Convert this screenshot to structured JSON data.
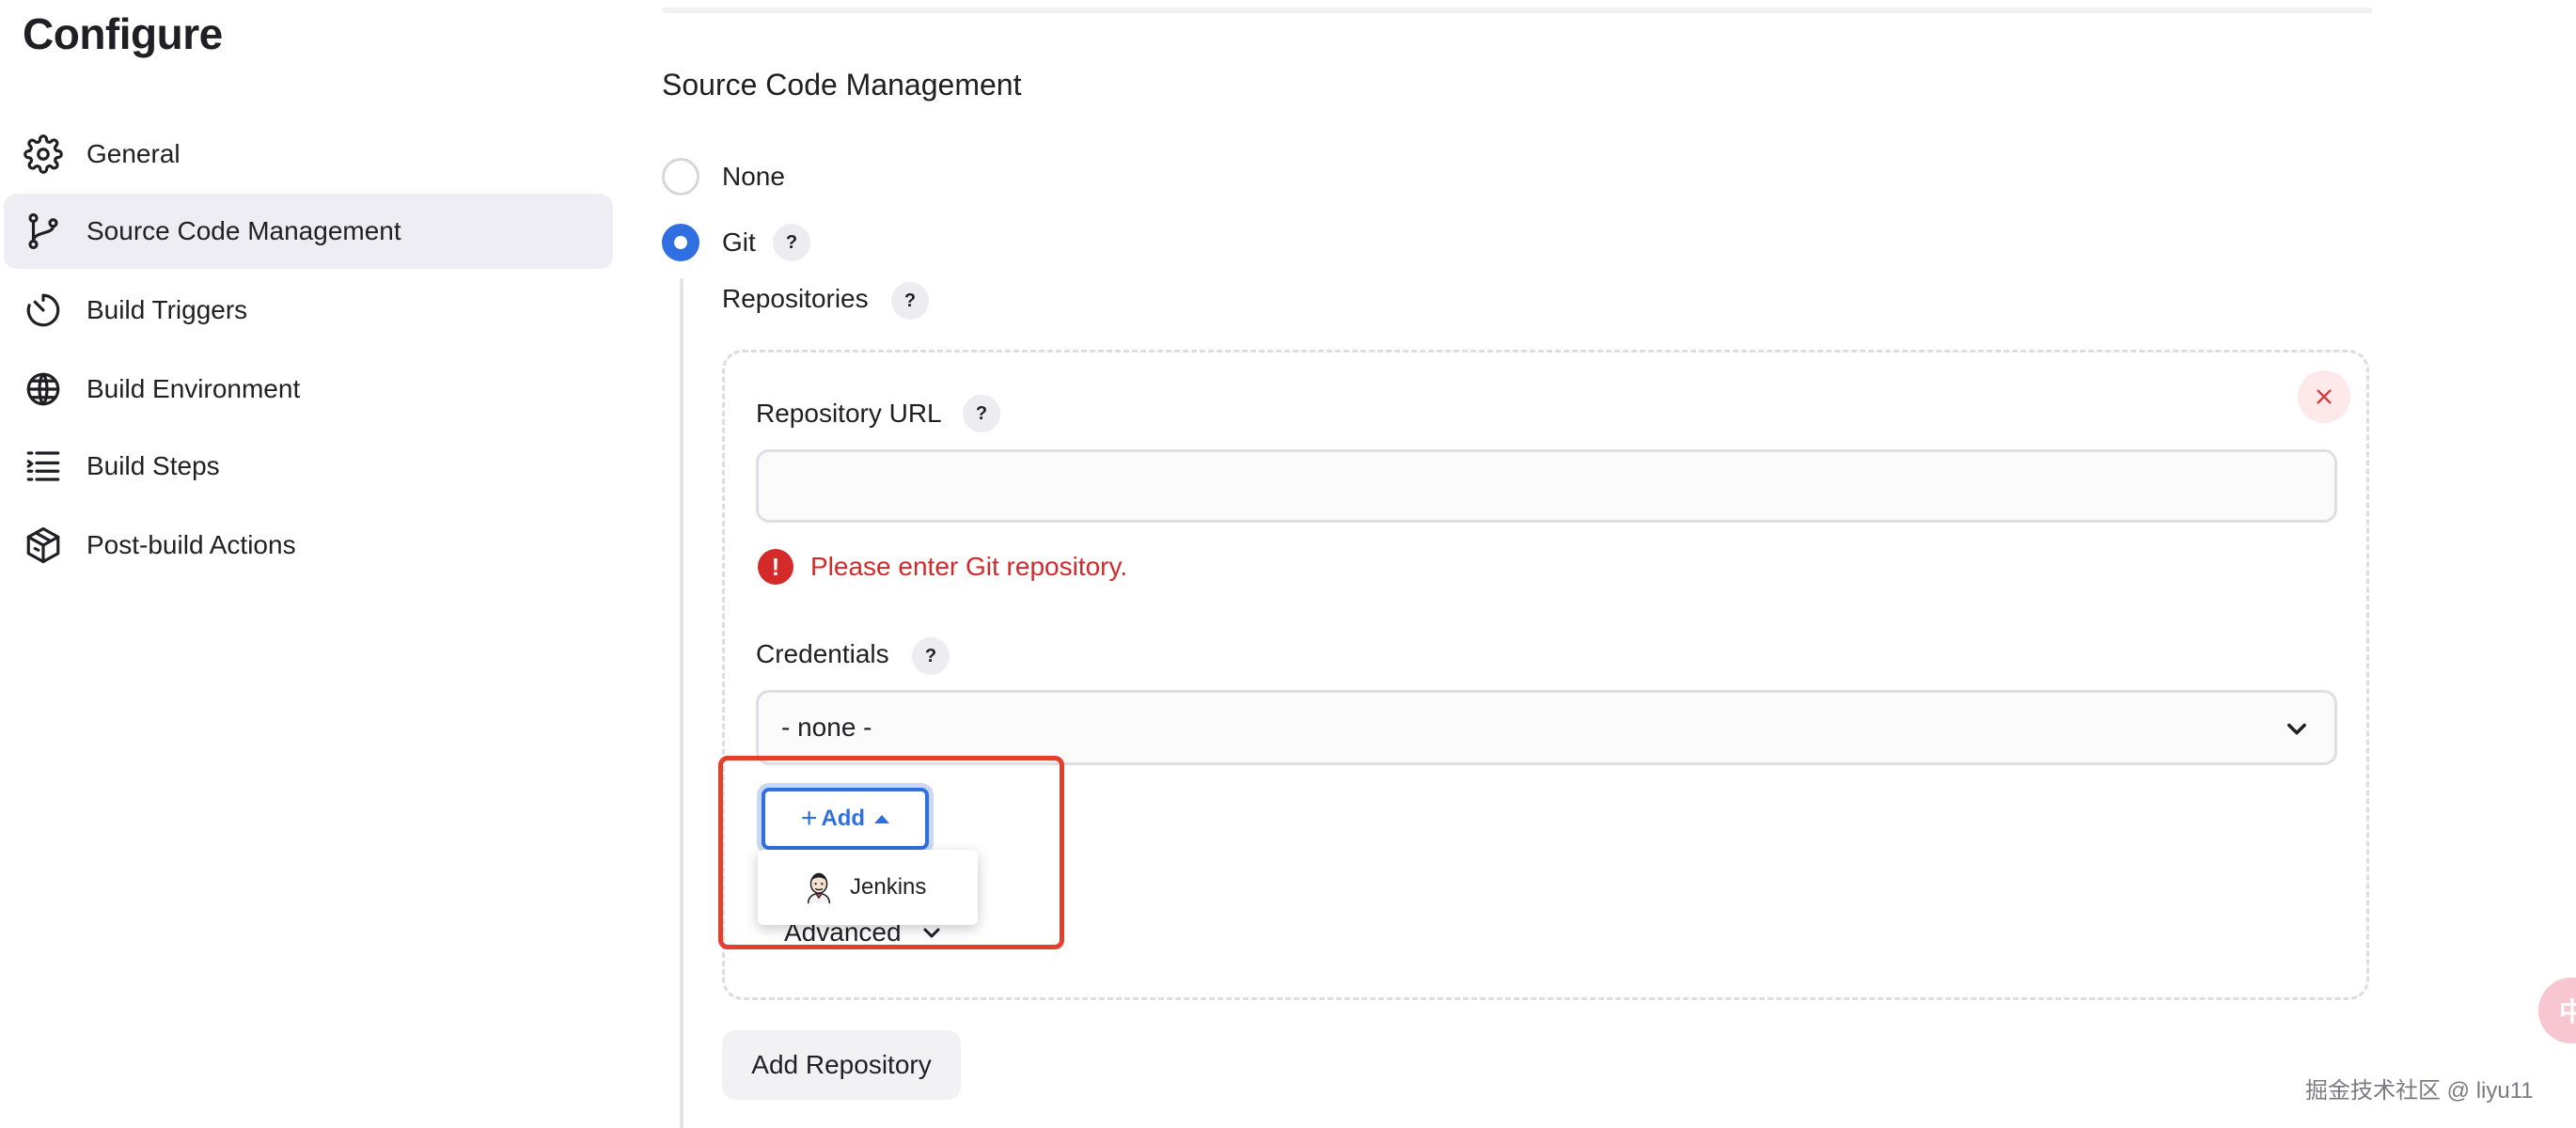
{
  "sidebar": {
    "title": "Configure",
    "items": [
      {
        "label": "General",
        "icon": "gear-icon",
        "active": false
      },
      {
        "label": "Source Code Management",
        "icon": "git-branch-icon",
        "active": true
      },
      {
        "label": "Build Triggers",
        "icon": "timer-icon",
        "active": false
      },
      {
        "label": "Build Environment",
        "icon": "globe-icon",
        "active": false
      },
      {
        "label": "Build Steps",
        "icon": "list-icon",
        "active": false
      },
      {
        "label": "Post-build Actions",
        "icon": "package-icon",
        "active": false
      }
    ]
  },
  "scm": {
    "title": "Source Code Management",
    "options": [
      {
        "label": "None",
        "selected": false
      },
      {
        "label": "Git",
        "selected": true
      }
    ],
    "help_symbol": "?",
    "repositories_label": "Repositories",
    "repo_url_label": "Repository URL",
    "repo_url_value": "",
    "repo_url_placeholder": "",
    "error_symbol": "!",
    "error_message": "Please enter Git repository.",
    "credentials_label": "Credentials",
    "credentials_selected": "- none -",
    "add_button": {
      "plus": "+",
      "label": "Add"
    },
    "dropdown_items": [
      {
        "label": "Jenkins",
        "icon": "jenkins-icon"
      }
    ],
    "advanced_label": "Advanced",
    "add_repository_label": "Add Repository"
  },
  "overlay": {
    "watermark": "掘金技术社区 @ liyu11",
    "side_bubble": "中"
  },
  "colors": {
    "accent": "#2f6fe0",
    "error": "#d22a2a",
    "highlight_border": "#e2402d",
    "active_nav_bg": "#ededf3"
  }
}
